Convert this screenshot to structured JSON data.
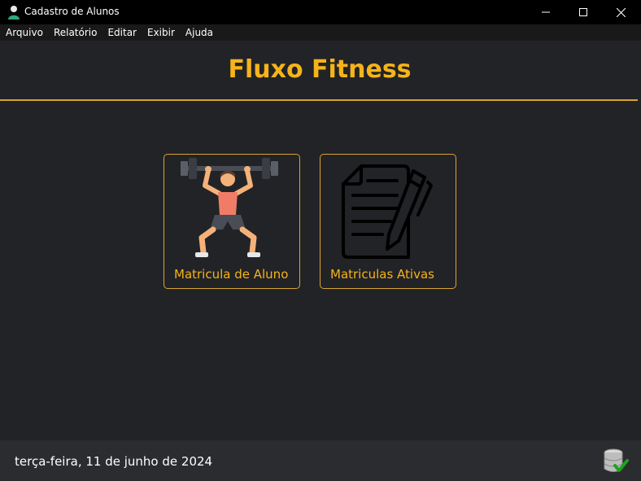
{
  "window": {
    "title": "Cadastro de Alunos",
    "icon": "user-icon"
  },
  "menu": [
    "Arquivo",
    "Relatório",
    "Editar",
    "Exibir",
    "Ajuda"
  ],
  "header": {
    "title": "Fluxo Fitness"
  },
  "cards": [
    {
      "label": "Matricula de Aluno",
      "icon": "weightlifter-icon"
    },
    {
      "label": "Matriculas Ativas",
      "icon": "document-pen-icon"
    }
  ],
  "status": {
    "date": "terça-feira, 11 de junho de 2024",
    "icon": "database-ok-icon"
  },
  "colors": {
    "accent": "#f5b41a",
    "background": "#222326",
    "statusbar": "#2b2c2f"
  }
}
